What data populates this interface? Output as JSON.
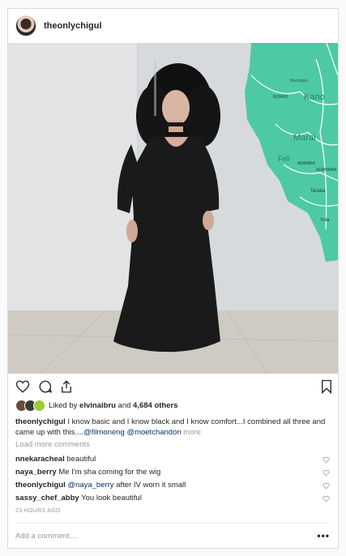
{
  "post": {
    "username": "theonlychigul",
    "likes_prefix": "Liked by ",
    "liked_by": "elvinaibru",
    "likes_middle": " and ",
    "likes_count": "4,684 others",
    "caption_user": "theonlychigul",
    "caption_text": " I know basic and I know black and I know comfort...I combined all three and came up with this....",
    "caption_tag1": "@filmoneng",
    "caption_tag2": "@moetchandon",
    "caption_more": "more",
    "load_more": "Load more comments",
    "comments": [
      {
        "user": "nnekaracheal",
        "text": "beautiful"
      },
      {
        "user": "naya_berry",
        "text": "Me I'm sha coming for the wig"
      },
      {
        "user": "theonlychigul",
        "tag": "@naya_berry",
        "text": " after IV worn it small"
      },
      {
        "user": "sassy_chef_abby",
        "text": "You look beautiful"
      }
    ],
    "timestamp": "23 HOURS AGO",
    "add_comment_placeholder": "Add a comment…",
    "more_label": "•••"
  },
  "photo": {
    "map_labels": [
      "Kano",
      "Maiduguri",
      "BORNO",
      "Marai",
      "Fell",
      "AWAMBA",
      "ADAMAWA",
      "Taraba",
      "Yola"
    ]
  },
  "colors": {
    "map": "#4ec9a5",
    "wall": "#d9dcde",
    "floor": "#cfcbc3",
    "dress": "#1a1a1a"
  }
}
